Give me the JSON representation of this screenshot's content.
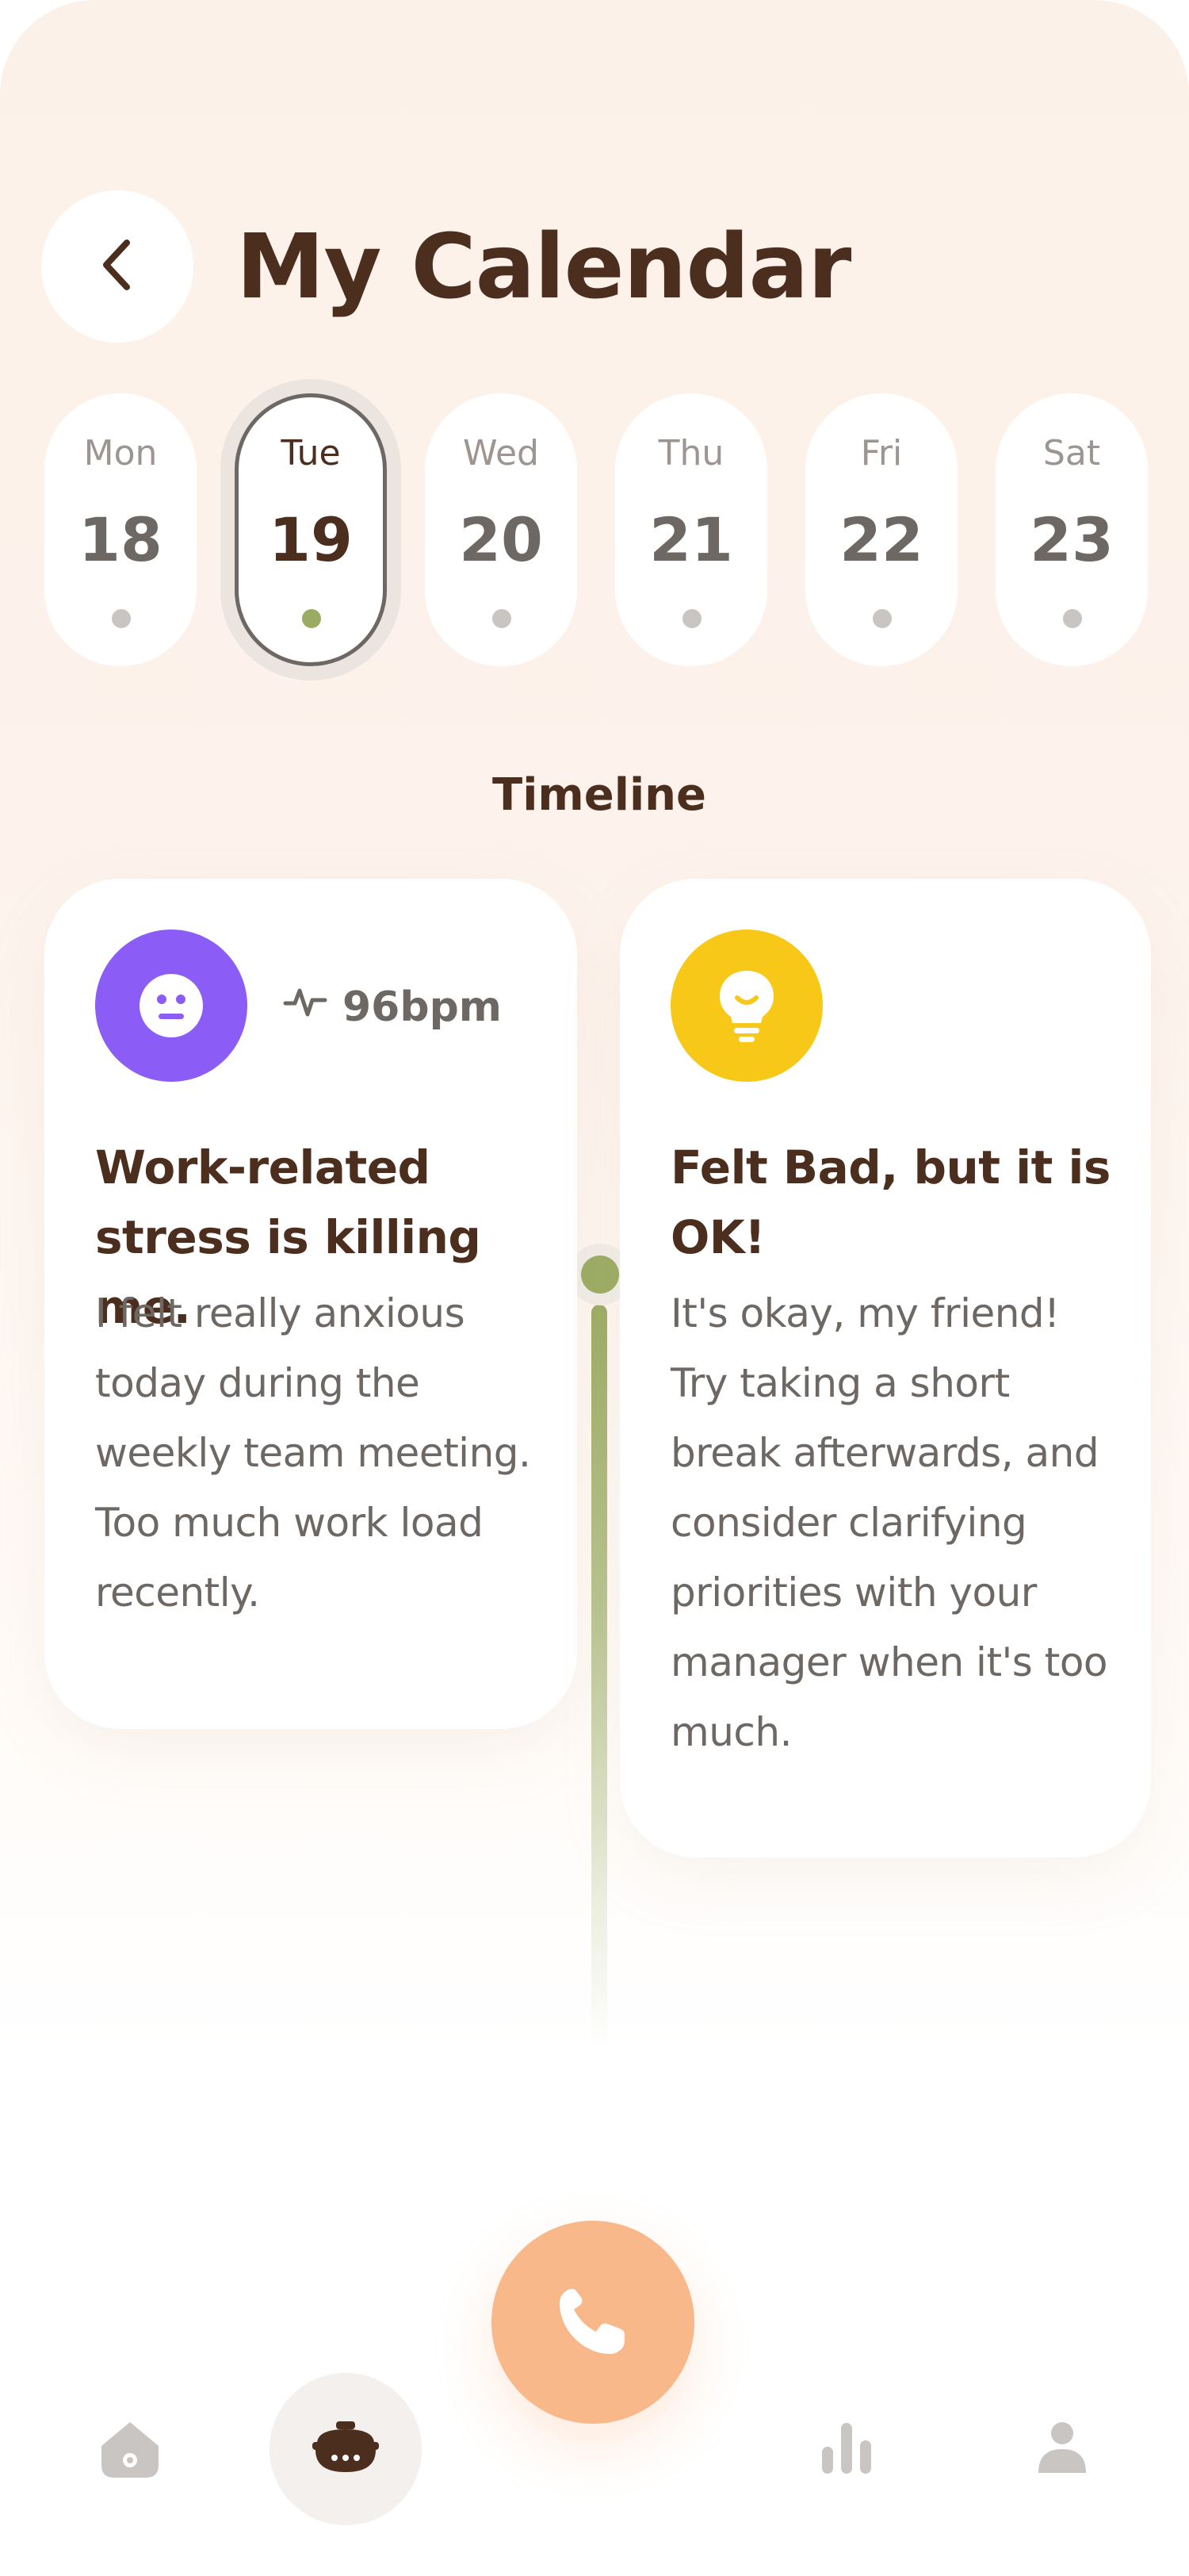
{
  "header": {
    "title": "My Calendar",
    "back_icon": "chevron-left-icon"
  },
  "days": [
    {
      "name": "Mon",
      "num": "18",
      "selected": false
    },
    {
      "name": "Tue",
      "num": "19",
      "selected": true
    },
    {
      "name": "Wed",
      "num": "20",
      "selected": false
    },
    {
      "name": "Thu",
      "num": "21",
      "selected": false
    },
    {
      "name": "Fri",
      "num": "22",
      "selected": false
    },
    {
      "name": "Sat",
      "num": "23",
      "selected": false
    }
  ],
  "timeline": {
    "label": "Timeline",
    "entries": [
      {
        "icon": "neutral-face-icon",
        "icon_color": "#8b5cf6",
        "bpm": "96bpm",
        "title": "Work-related stress is killing me.",
        "text": "I felt really anxious today during the weekly team meeting. Too much work load recently."
      },
      {
        "icon": "lightbulb-icon",
        "icon_color": "#f8c818",
        "title": "Felt Bad, but it is OK!",
        "text": "It's okay, my friend! Try taking a short break afterwards, and consider clarifying priorities with your manager when it's too much."
      }
    ]
  },
  "nav": {
    "items": [
      "home-icon",
      "journal-icon",
      "call-icon",
      "stats-icon",
      "profile-icon"
    ],
    "active": "journal-icon",
    "call_color": "#f8b88a"
  },
  "colors": {
    "brown": "#4b2e1e",
    "gray": "#6e6865",
    "green": "#9bac62",
    "purple": "#8b5cf6",
    "yellow": "#f8c818"
  }
}
